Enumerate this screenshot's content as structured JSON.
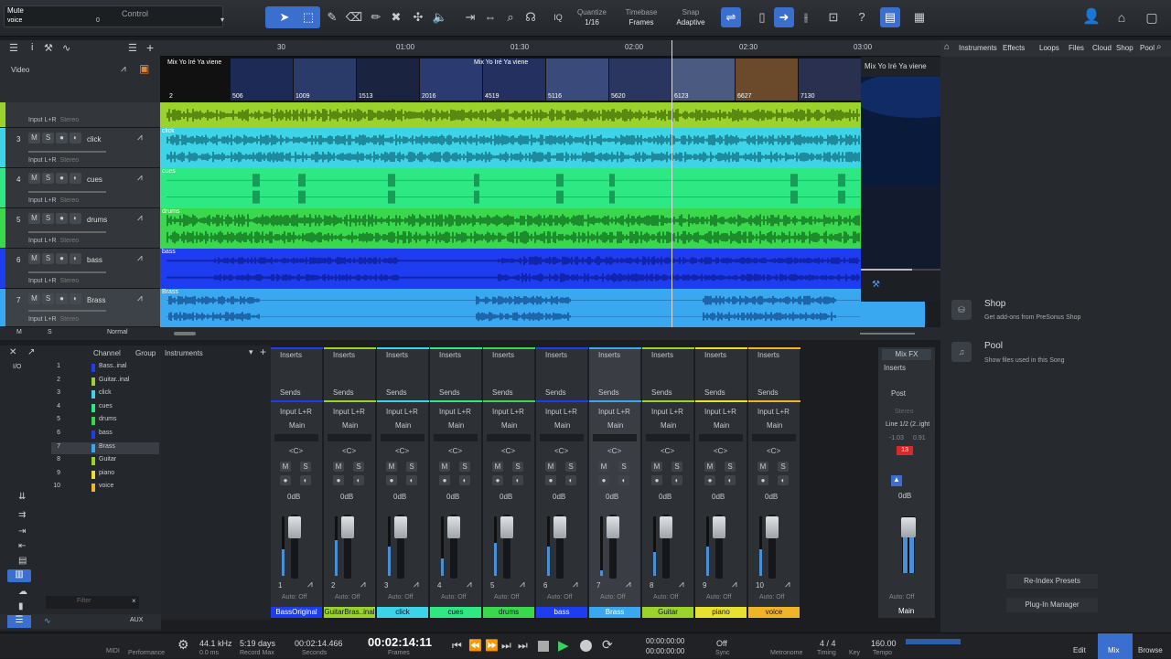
{
  "toolbar": {
    "mute_label": "Mute",
    "voice_label": "voice",
    "zero_label": "0",
    "control_label": "Control",
    "quantize_label": "Quantize",
    "quantize_value": "1/16",
    "timebase_label": "Timebase",
    "timebase_value": "Frames",
    "snap_label": "Snap",
    "snap_value": "Adaptive",
    "iq_label": "IQ",
    "help_label": "?"
  },
  "arrange": {
    "video_label": "Video",
    "ruler": [
      "30",
      "01:00",
      "01:30",
      "02:00",
      "02:30",
      "03:00"
    ],
    "video_clip_label": "Mix Yo Iré  Ya viene",
    "frame_numbers": [
      "2",
      "506",
      "1009",
      "1513",
      "2016",
      "4519",
      "5116",
      "5620",
      "6123",
      "6627",
      "7130"
    ],
    "tracks": [
      {
        "num": "",
        "name": "",
        "input": "Input L+R",
        "stereo": "Stereo",
        "color": "#9bd32c",
        "lane_label": ""
      },
      {
        "num": "3",
        "name": "click",
        "input": "Input L+R",
        "stereo": "Stereo",
        "color": "#3ed4e8",
        "lane_label": "click"
      },
      {
        "num": "4",
        "name": "cues",
        "input": "Input L+R",
        "stereo": "Stereo",
        "color": "#2ee884",
        "lane_label": "cues"
      },
      {
        "num": "5",
        "name": "drums",
        "input": "Input L+R",
        "stereo": "Stereo",
        "color": "#3ad84c",
        "lane_label": "drums"
      },
      {
        "num": "6",
        "name": "bass",
        "input": "Input L+R",
        "stereo": "Stereo",
        "color": "#1f3df0",
        "lane_label": "bass"
      },
      {
        "num": "7",
        "name": "Brass",
        "input": "Input L+R",
        "stereo": "Stereo",
        "color": "#3aa8f0",
        "lane_label": "Brass"
      }
    ],
    "footer_m": "M",
    "footer_s": "S",
    "footer_normal": "Normal"
  },
  "video_window": {
    "title": "Mix Yo Iré  Ya viene"
  },
  "browser": {
    "tabs": [
      "Instruments",
      "Effects",
      "Loops",
      "Files",
      "Cloud",
      "Shop",
      "Pool"
    ],
    "items": [
      {
        "title": "Shop",
        "desc": "Get add-ons from PreSonus Shop"
      },
      {
        "title": "Pool",
        "desc": "Show files used in this Song"
      }
    ],
    "reindex": "Re-Index Presets",
    "plugin_manager": "Plug-In Manager"
  },
  "mixer_left": {
    "header_channel": "Channel",
    "header_group": "Group",
    "instruments_label": "Instruments",
    "io_label": "I/O",
    "filter_placeholder": "Filter",
    "channels": [
      {
        "n": "1",
        "name": "Bass..inal",
        "color": "#1f3df0"
      },
      {
        "n": "2",
        "name": "Guitar..inal",
        "color": "#9bd32c"
      },
      {
        "n": "3",
        "name": "click",
        "color": "#3ed4e8"
      },
      {
        "n": "4",
        "name": "cues",
        "color": "#2ee884"
      },
      {
        "n": "5",
        "name": "drums",
        "color": "#3ad84c"
      },
      {
        "n": "6",
        "name": "bass",
        "color": "#1f3df0"
      },
      {
        "n": "7",
        "name": "Brass",
        "color": "#3aa8f0"
      },
      {
        "n": "8",
        "name": "Guitar",
        "color": "#9bd32c"
      },
      {
        "n": "9",
        "name": "piano",
        "color": "#e8e030"
      },
      {
        "n": "10",
        "name": "voice",
        "color": "#f0b428"
      }
    ],
    "aux_label": "AUX"
  },
  "mixer": {
    "inserts": "Inserts",
    "sends": "Sends",
    "input": "Input L+R",
    "main": "Main",
    "pan": "<C>",
    "db": "0dB",
    "auto": "Auto: Off",
    "m": "M",
    "s": "S",
    "strips": [
      {
        "num": "1",
        "name": "BassOriginal",
        "color": "#1f3df0",
        "level": 0.45
      },
      {
        "num": "2",
        "name": "GuitarBras..inal",
        "color": "#9bd32c",
        "level": 0.6
      },
      {
        "num": "3",
        "name": "click",
        "color": "#3ed4e8",
        "level": 0.5
      },
      {
        "num": "4",
        "name": "cues",
        "color": "#2ee884",
        "level": 0.3
      },
      {
        "num": "5",
        "name": "drums",
        "color": "#3ad84c",
        "level": 0.55
      },
      {
        "num": "6",
        "name": "bass",
        "color": "#1f3df0",
        "level": 0.5
      },
      {
        "num": "7",
        "name": "Brass",
        "color": "#3aa8f0",
        "level": 0.1
      },
      {
        "num": "8",
        "name": "Guitar",
        "color": "#9bd32c",
        "level": 0.4
      },
      {
        "num": "9",
        "name": "piano",
        "color": "#e8e030",
        "level": 0.5
      },
      {
        "num": "10",
        "name": "voice",
        "color": "#f0b428",
        "level": 0.45
      }
    ],
    "main_strip": {
      "mixfx": "Mix FX",
      "inserts": "Inserts",
      "post": "Post",
      "stereo": "Stereo",
      "line": "Line 1/2 (2..ight",
      "v1": "-1.03",
      "v2": "0.91",
      "clip": "13",
      "db": "0dB",
      "auto": "Auto: Off",
      "name": "Main"
    }
  },
  "status": {
    "midi": "MIDI",
    "performance": "Performance",
    "rate": "44.1 kHz",
    "ms": "0.0 ms",
    "days": "5:19 days",
    "record_max": "Record Max",
    "seconds_val": "00:02:14.466",
    "seconds_lbl": "Seconds",
    "frames_val": "00:02:14:11",
    "frames_lbl": "Frames",
    "loop_l": "00:00:00:00",
    "loop_r": "00:00:00:00",
    "sync_val": "Off",
    "sync_lbl": "Sync",
    "metronome": "Metronome",
    "sig": "4 / 4",
    "timing": "Timing",
    "key": "Key",
    "tempo_val": "160.00",
    "tempo_lbl": "Tempo",
    "edit": "Edit",
    "mix": "Mix",
    "browse": "Browse"
  }
}
